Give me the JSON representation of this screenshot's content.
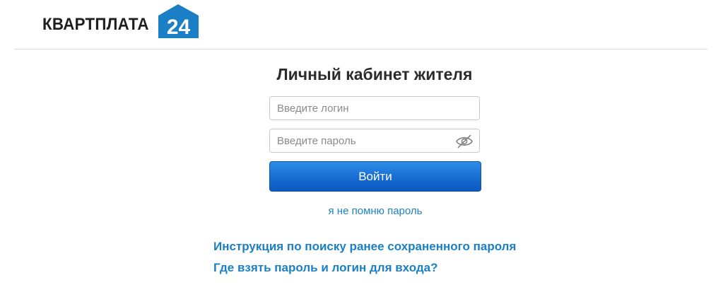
{
  "header": {
    "logo_text": "КВАРТПЛАТА",
    "logo_number": "24",
    "brand_color": "#1a7fc4"
  },
  "login_form": {
    "title": "Личный кабинет жителя",
    "login_placeholder": "Введите логин",
    "login_value": "",
    "password_placeholder": "Введите пароль",
    "password_value": "",
    "password_toggle_icon": "eye-slash-icon",
    "submit_label": "Войти",
    "forgot_password_link": "я не помню пароль",
    "button_color": "#1a6fd3",
    "link_color": "#1a83c6"
  },
  "help_links": [
    {
      "label": "Инструкция по поиску ранее сохраненного пароля"
    },
    {
      "label": "Где взять пароль и логин для входа?"
    }
  ]
}
